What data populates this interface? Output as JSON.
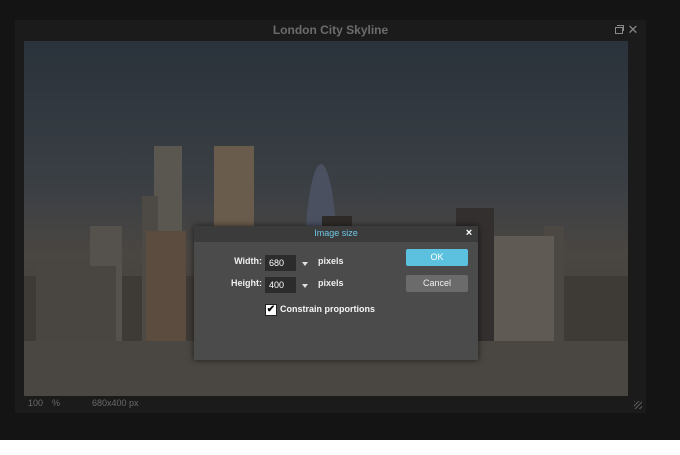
{
  "window": {
    "title": "London City Skyline"
  },
  "status": {
    "zoom_value": "100",
    "zoom_unit": "%",
    "dimensions": "680x400 px"
  },
  "dialog": {
    "title": "Image size",
    "close": "×",
    "width_label": "Width:",
    "width_value": "680",
    "height_label": "Height:",
    "height_value": "400",
    "unit": "pixels",
    "ok": "OK",
    "cancel": "Cancel",
    "constrain_label": "Constrain proportions",
    "constrain_checked": true,
    "check_mark": "✔"
  },
  "colors": {
    "accent": "#5bc1de",
    "dialog_bg": "#4b4b4b",
    "app_bg": "#141414"
  }
}
